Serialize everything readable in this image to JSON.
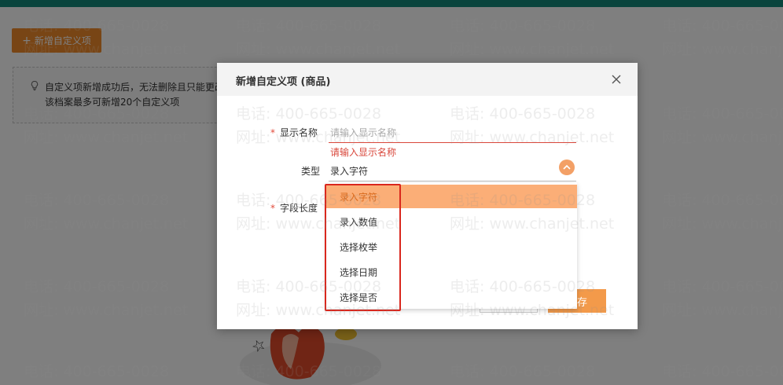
{
  "background": {
    "add_button_label": "新增自定义项",
    "tip_line1": "自定义项新增成功后，无法删除且只能更改",
    "tip_line2": "该档案最多可新增20个自定义项"
  },
  "watermark": {
    "phone_text": "电话: 400-665-0028",
    "site_text": "网址: www.chanjet.net"
  },
  "dialog": {
    "title": "新增自定义项 (商品)",
    "fields": {
      "display_name": {
        "label": "显示名称",
        "placeholder": "请输入显示名称",
        "error": "请输入显示名称"
      },
      "type": {
        "label": "类型",
        "value": "录入字符"
      },
      "field_length": {
        "label": "字段长度"
      }
    },
    "save_label": "保存",
    "dropdown": {
      "options": [
        "录入字符",
        "录入数值",
        "选择枚举",
        "选择日期",
        "选择是否"
      ],
      "selected": "录入字符"
    }
  },
  "colors": {
    "accent": "#f08a2b",
    "topbar": "#12897a",
    "error": "#d9473b",
    "selected_option_bg": "#fbae77",
    "highlight_box": "#d9271d"
  }
}
